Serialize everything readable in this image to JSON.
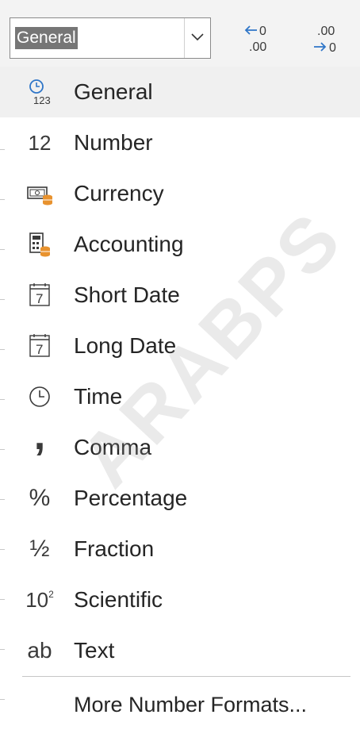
{
  "toolbar": {
    "format_value": "General",
    "increase_decimal_top": "0",
    "increase_decimal_bottom": ".00",
    "decrease_decimal_top": ".00",
    "decrease_decimal_bottom": "0"
  },
  "menu": {
    "items": [
      {
        "label": "General",
        "icon": "general-clock-123-icon",
        "selected": true
      },
      {
        "label": "Number",
        "icon": "number-12-icon",
        "icon_text": "12"
      },
      {
        "label": "Currency",
        "icon": "currency-icon"
      },
      {
        "label": "Accounting",
        "icon": "accounting-calculator-icon"
      },
      {
        "label": "Short Date",
        "icon": "calendar-icon",
        "icon_text": "7"
      },
      {
        "label": "Long Date",
        "icon": "calendar-icon",
        "icon_text": "7"
      },
      {
        "label": "Time",
        "icon": "clock-icon"
      },
      {
        "label": "Comma",
        "icon": "comma-icon",
        "icon_text": ","
      },
      {
        "label": "Percentage",
        "icon": "percent-icon",
        "icon_text": "%"
      },
      {
        "label": "Fraction",
        "icon": "fraction-icon",
        "icon_text": "½"
      },
      {
        "label": "Scientific",
        "icon": "scientific-icon",
        "icon_text": "10",
        "icon_sup": "2"
      },
      {
        "label": "Text",
        "icon": "text-ab-icon",
        "icon_text": "ab"
      }
    ],
    "more_label": "More Number Formats..."
  },
  "watermark": "ARABPS",
  "colors": {
    "accent_orange": "#e8922e",
    "selected_bg": "#f0f0f0",
    "arrow_blue": "#2f76c8",
    "text": "#252525"
  }
}
